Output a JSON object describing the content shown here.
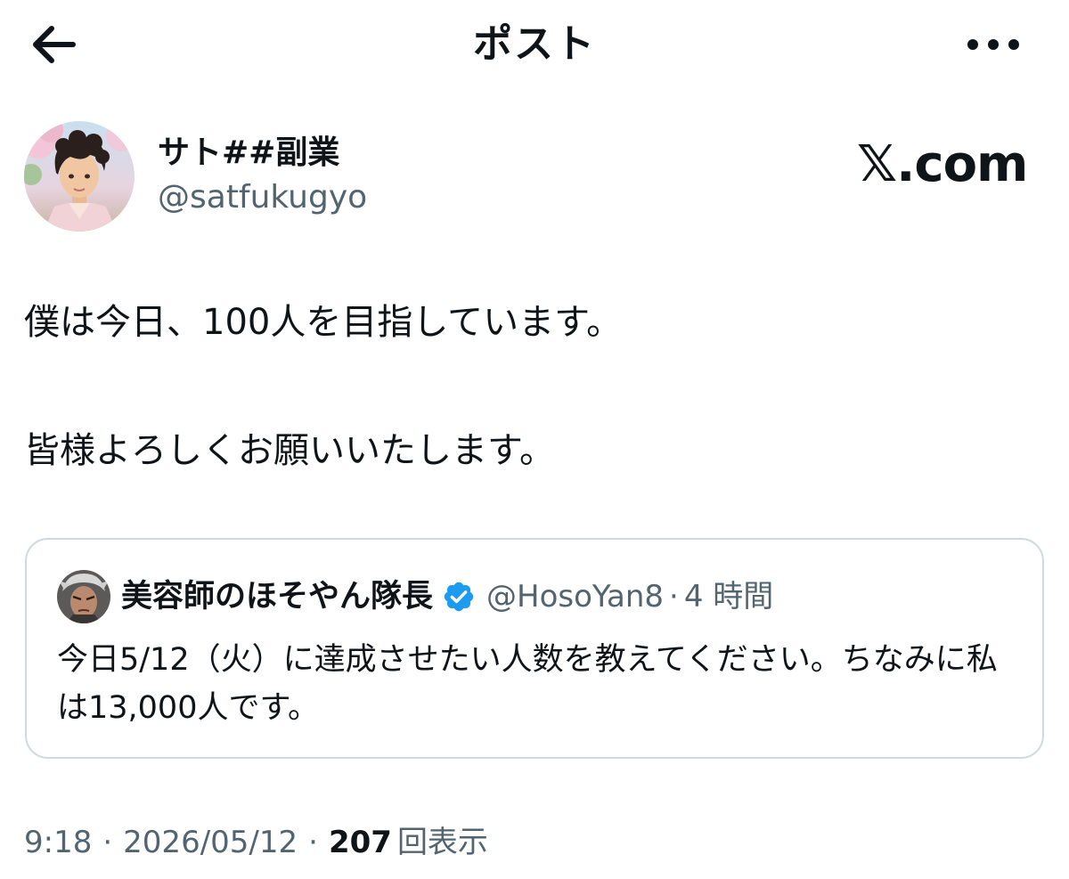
{
  "header": {
    "title": "ポスト",
    "back_icon": "arrow-left-icon",
    "more_icon": "more-horizontal-icon"
  },
  "author": {
    "name": "サト##副業",
    "handle": "@satfukugyo",
    "avatar_icon": "avatar-photo"
  },
  "brand": {
    "text": "𝕏.com"
  },
  "post": {
    "lines": [
      "僕は今日、100人を目指しています。",
      "皆様よろしくお願いいたします。"
    ]
  },
  "quote": {
    "name": "美容師のほそやん隊長",
    "verified_icon": "verified-badge-icon",
    "verified_color": "#1d9bf0",
    "handle": "@HosoYan8",
    "separator": "·",
    "time": "4 時間",
    "text": "今日5/12（火）に達成させたい人数を教えてください。ちなみに私は13,000人です。"
  },
  "meta": {
    "time": "9:18",
    "separator": "·",
    "date": "2026/05/12",
    "views": "207",
    "views_label": "回表示"
  },
  "colors": {
    "text": "#0f1419",
    "secondary": "#536471",
    "border": "#cfd9de",
    "accent": "#1d9bf0"
  }
}
